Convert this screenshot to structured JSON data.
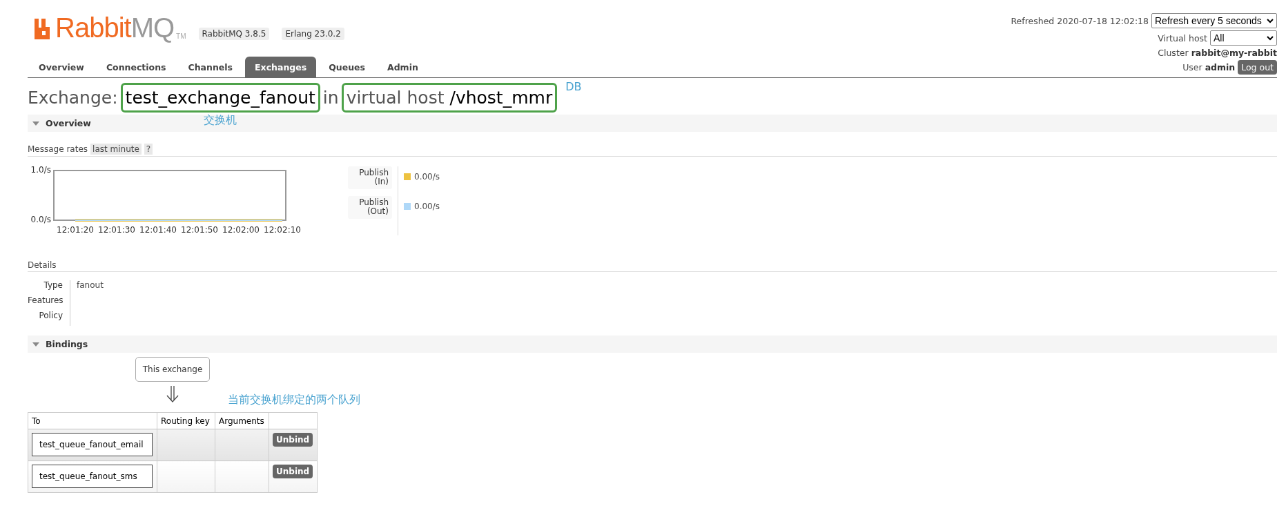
{
  "header": {
    "logo": {
      "brand": "Rabbit",
      "suffix": "MQ",
      "tm": "TM"
    },
    "versions": [
      "RabbitMQ 3.8.5",
      "Erlang 23.0.2"
    ]
  },
  "tabs": [
    {
      "label": "Overview",
      "selected": false
    },
    {
      "label": "Connections",
      "selected": false
    },
    {
      "label": "Channels",
      "selected": false
    },
    {
      "label": "Exchanges",
      "selected": true
    },
    {
      "label": "Queues",
      "selected": false
    },
    {
      "label": "Admin",
      "selected": false
    }
  ],
  "status": {
    "refreshed": "Refreshed 2020-07-18 12:02:18",
    "refresh_select": "Refresh every 5 seconds",
    "vhost_label": "Virtual host",
    "vhost_select": "All",
    "cluster_label": "Cluster",
    "cluster": "rabbit@my-rabbit",
    "user_label": "User",
    "user": "admin",
    "logout": "Log out"
  },
  "heading": {
    "prefix": "Exchange:",
    "name": "test_exchange_fanout",
    "name_note": "交换机",
    "joiner": "in",
    "vhost_label": "virtual host",
    "vhost": "/vhost_mmr",
    "vhost_note": "DB"
  },
  "overview": {
    "title": "Overview",
    "expanded": true,
    "rates_label": "Message rates",
    "range": "last minute",
    "help": "?",
    "chart_data": {
      "type": "line",
      "categories": [
        "12:01:20",
        "12:01:30",
        "12:01:40",
        "12:01:50",
        "12:02:00",
        "12:02:10"
      ],
      "ylim": [
        0,
        1
      ],
      "yticks": [
        {
          "value": 0,
          "label": "0.0/s"
        },
        {
          "value": 1,
          "label": "1.0/s"
        }
      ],
      "series": [
        {
          "name": "Publish (In)",
          "color": "#edc240",
          "values": [
            0,
            0,
            0,
            0,
            0,
            0
          ]
        },
        {
          "name": "Publish (Out)",
          "color": "#afd8f8",
          "values": [
            0,
            0,
            0,
            0,
            0,
            0
          ]
        }
      ]
    },
    "readings": [
      "0.00/s",
      "0.00/s"
    ]
  },
  "details": {
    "title": "Details",
    "rows": [
      {
        "label": "Type",
        "value": "fanout"
      },
      {
        "label": "Features"
      },
      {
        "label": "Policy"
      }
    ]
  },
  "bindings": {
    "title": "Bindings",
    "expanded": true,
    "source": "This exchange",
    "note": "当前交换机绑定的两个队列",
    "columns": [
      "To",
      "Routing key",
      "Arguments"
    ],
    "rows": [
      {
        "to": "test_queue_fanout_email",
        "action": "Unbind"
      },
      {
        "to": "test_queue_fanout_sms",
        "action": "Unbind"
      }
    ]
  }
}
